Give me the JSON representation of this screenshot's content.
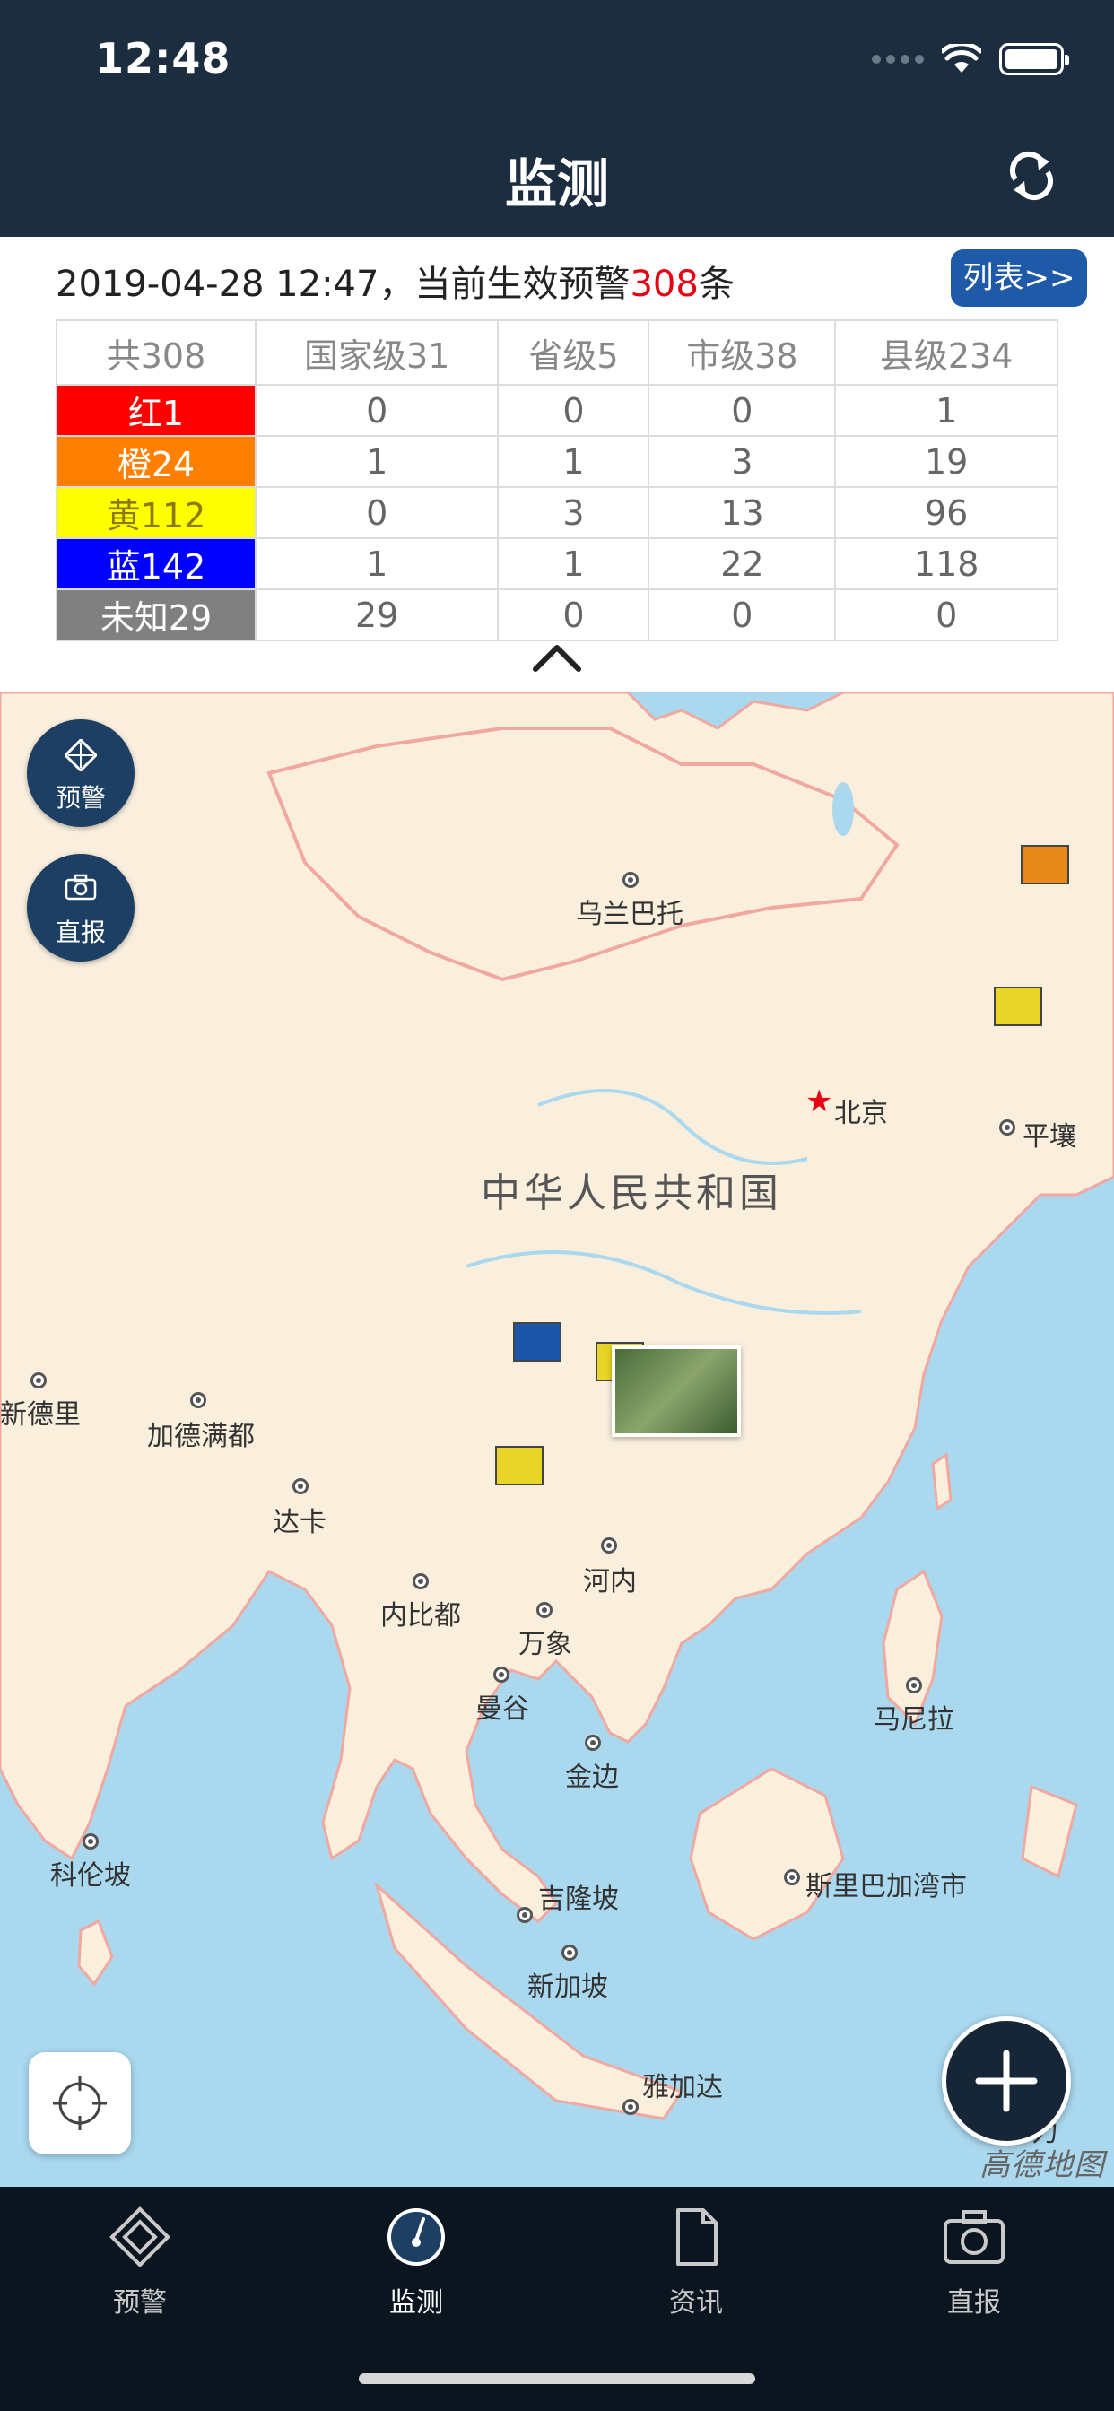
{
  "status_bar": {
    "time": "12:48"
  },
  "header": {
    "title": "监测",
    "refresh_icon": "refresh-icon"
  },
  "summary": {
    "prefix": "2019-04-28 12:47，当前生效预警",
    "count": "308",
    "suffix": "条",
    "list_button": "列表>>",
    "colors": {
      "accent": "#1e5aa8",
      "count": "#e60012"
    }
  },
  "table": {
    "headers": [
      "共308",
      "国家级31",
      "省级5",
      "市级38",
      "县级234"
    ],
    "rows": [
      {
        "label": "红1",
        "color": "#ff0000",
        "values": [
          "0",
          "0",
          "0",
          "1"
        ]
      },
      {
        "label": "橙24",
        "color": "#ff7f00",
        "values": [
          "1",
          "1",
          "3",
          "19"
        ]
      },
      {
        "label": "黄112",
        "color": "#ffff00",
        "values": [
          "0",
          "3",
          "13",
          "96"
        ]
      },
      {
        "label": "蓝142",
        "color": "#0000ff",
        "values": [
          "1",
          "1",
          "22",
          "118"
        ]
      },
      {
        "label": "未知29",
        "color": "#808080",
        "values": [
          "29",
          "0",
          "0",
          "0"
        ]
      }
    ]
  },
  "map": {
    "side_buttons": {
      "warning": "预警",
      "live": "直报"
    },
    "country_label": "中华人民共和国",
    "cities": {
      "ulaanbaatar": "乌兰巴托",
      "beijing": "北京",
      "pyongyang": "平壤",
      "new_delhi": "新德里",
      "kathmandu": "加德满都",
      "dhaka": "达卡",
      "naypyidaw": "内比都",
      "hanoi": "河内",
      "vientiane": "万象",
      "bangkok": "曼谷",
      "phnom_penh": "金边",
      "manila": "马尼拉",
      "colombo": "科伦坡",
      "kuala_lumpur": "吉隆坡",
      "singapore": "新加坡",
      "bandar_seri_begawan": "斯里巴加湾市",
      "jakarta": "雅加达",
      "partial": "力"
    },
    "provider_logo": "高德地图"
  },
  "tabbar": {
    "items": [
      {
        "label": "预警",
        "icon": "warning-diamond-icon"
      },
      {
        "label": "监测",
        "icon": "gauge-icon"
      },
      {
        "label": "资讯",
        "icon": "document-icon"
      },
      {
        "label": "直报",
        "icon": "camera-icon"
      }
    ]
  }
}
